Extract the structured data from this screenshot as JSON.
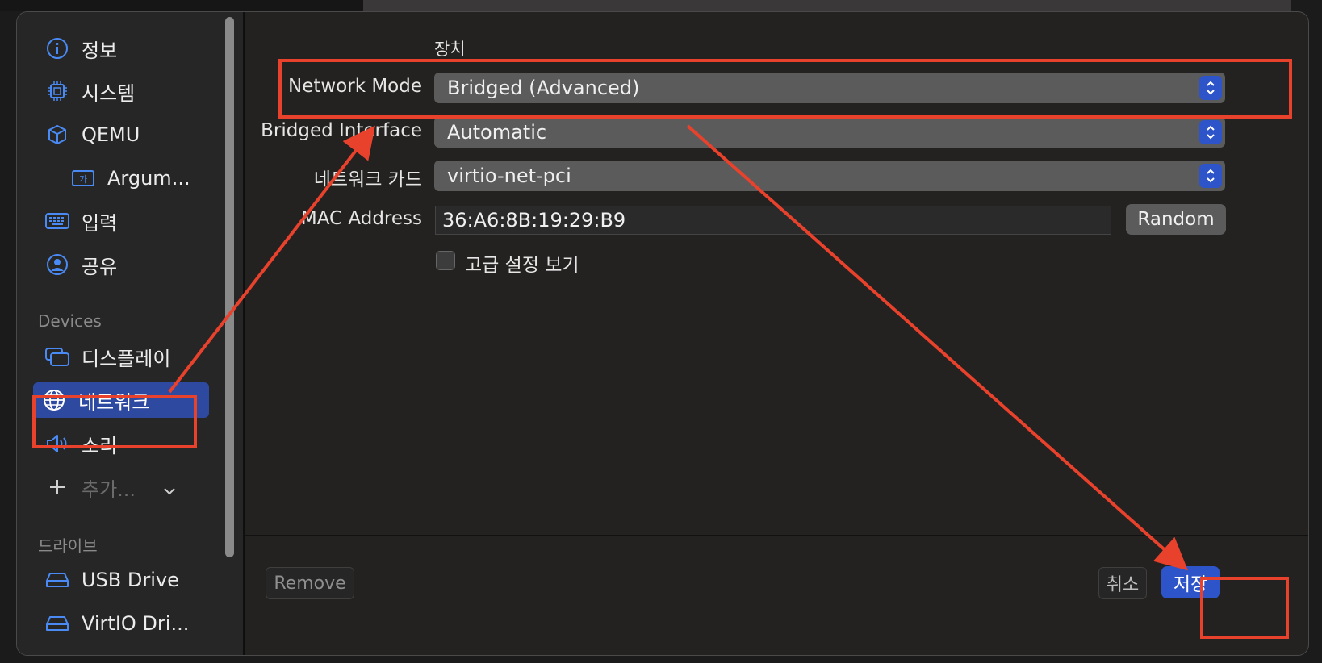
{
  "sidebar": {
    "items": [
      {
        "label": "정보",
        "icon": "info-icon"
      },
      {
        "label": "시스템",
        "icon": "cpu-chip-icon"
      },
      {
        "label": "QEMU",
        "icon": "cube-icon"
      },
      {
        "label": "Argum...",
        "icon": "text-format-icon"
      },
      {
        "label": "입력",
        "icon": "keyboard-icon"
      },
      {
        "label": "공유",
        "icon": "person-circle-icon"
      }
    ],
    "devices_header": "Devices",
    "devices": [
      {
        "label": "디스플레이",
        "icon": "display-icon"
      },
      {
        "label": "네트워크",
        "icon": "globe-icon",
        "selected": true
      },
      {
        "label": "소리",
        "icon": "speaker-icon"
      }
    ],
    "add_label": "추가...",
    "drives_header": "드라이브",
    "drives": [
      {
        "label": "USB Drive",
        "icon": "drive-icon"
      },
      {
        "label": "VirtIO Dri...",
        "icon": "drive-icon"
      }
    ]
  },
  "main": {
    "section_title": "장치",
    "network_mode": {
      "label": "Network Mode",
      "value": "Bridged (Advanced)"
    },
    "bridged_interface": {
      "label": "Bridged Interface",
      "value": "Automatic"
    },
    "network_card": {
      "label": "네트워크 카드",
      "value": "virtio-net-pci"
    },
    "mac_address": {
      "label": "MAC Address",
      "value": "36:A6:8B:19:29:B9",
      "random_label": "Random"
    },
    "advanced_checkbox": {
      "label": "고급 설정 보기",
      "checked": false
    }
  },
  "footer": {
    "remove_label": "Remove",
    "cancel_label": "취소",
    "save_label": "저장"
  },
  "colors": {
    "accent": "#2d54c9",
    "annotation": "#e8412c"
  }
}
